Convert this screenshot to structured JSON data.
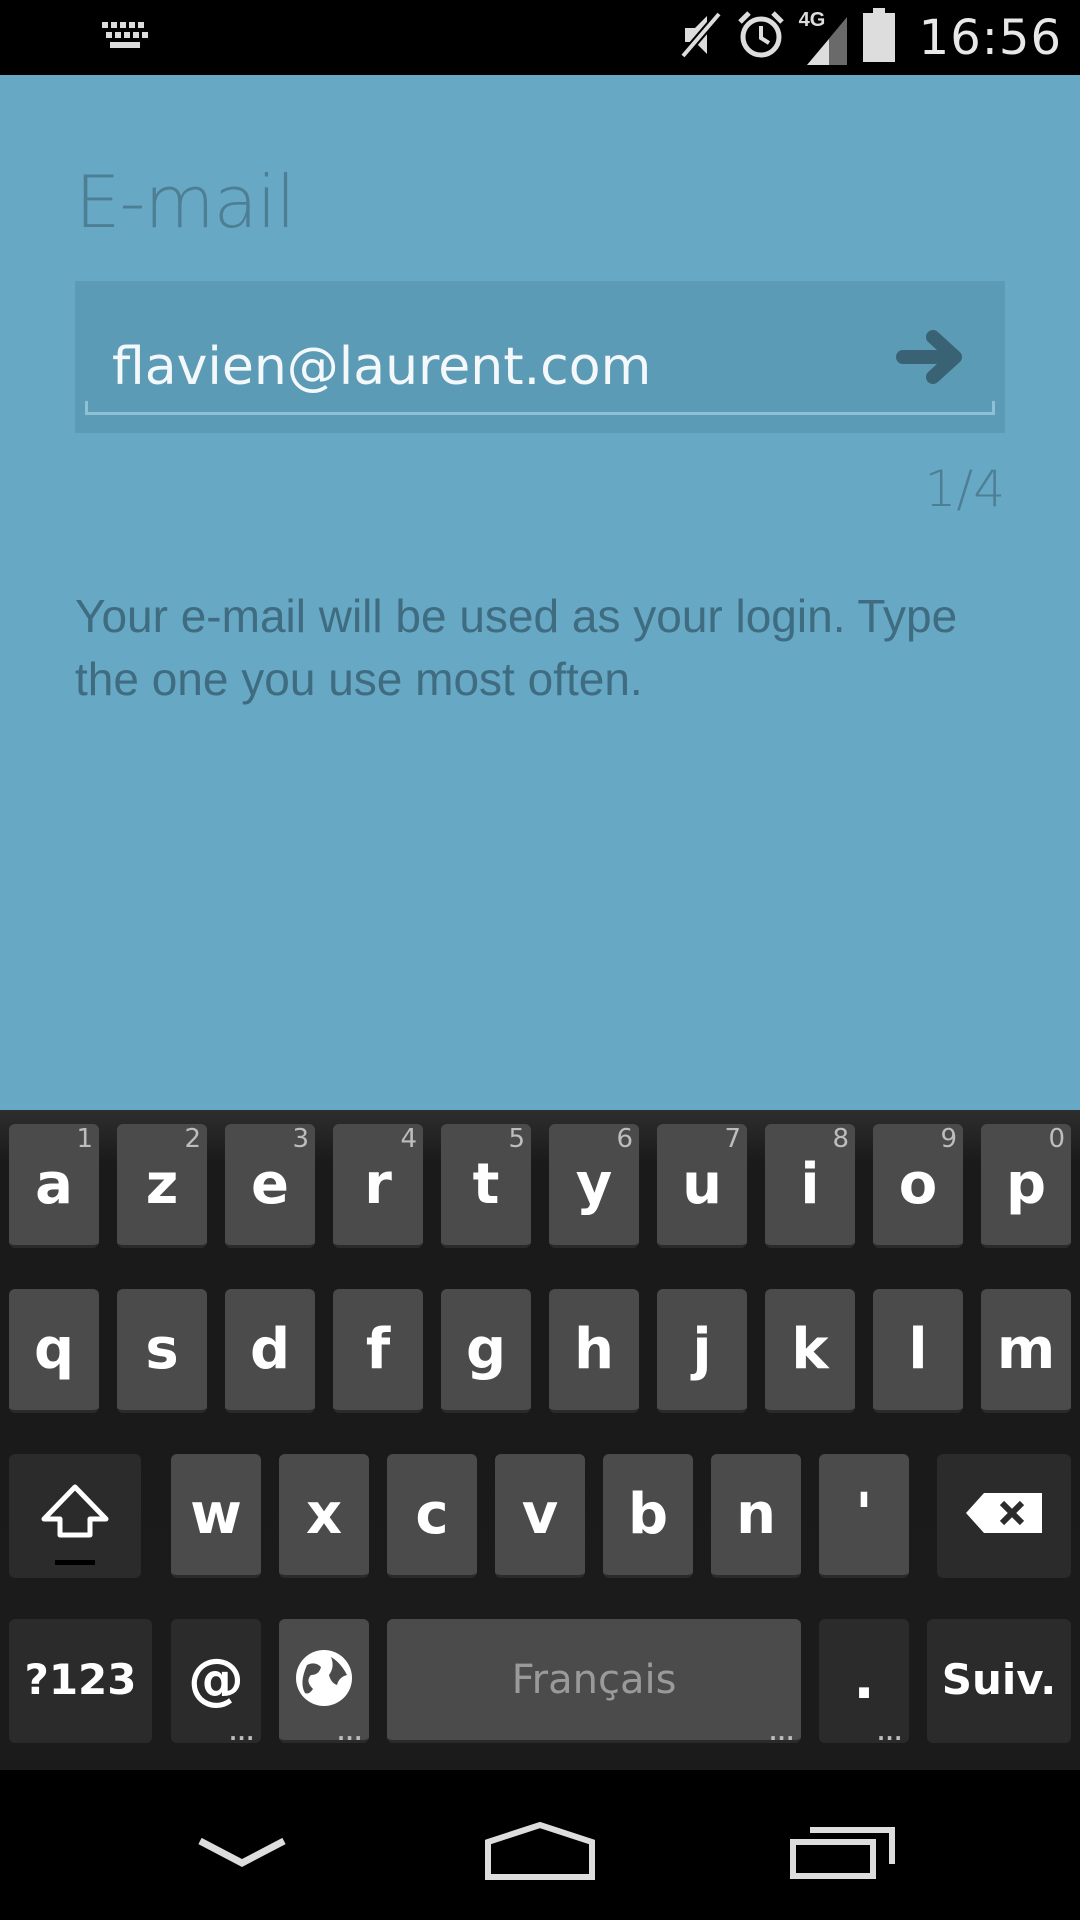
{
  "status_bar": {
    "time": "16:56",
    "network": "4G",
    "icons": [
      "keyboard-icon",
      "mute-icon",
      "alarm-icon",
      "signal-icon",
      "battery-icon"
    ]
  },
  "form": {
    "title": "E-mail",
    "email_value": "flavien@laurent.com",
    "step_counter": "1/4",
    "help_text": "Your e-mail will be used as your login. Type the one you use most often.",
    "next_icon": "arrow-right-icon"
  },
  "keyboard": {
    "row1": [
      {
        "label": "a",
        "hint": "1"
      },
      {
        "label": "z",
        "hint": "2"
      },
      {
        "label": "e",
        "hint": "3"
      },
      {
        "label": "r",
        "hint": "4"
      },
      {
        "label": "t",
        "hint": "5"
      },
      {
        "label": "y",
        "hint": "6"
      },
      {
        "label": "u",
        "hint": "7"
      },
      {
        "label": "i",
        "hint": "8"
      },
      {
        "label": "o",
        "hint": "9"
      },
      {
        "label": "p",
        "hint": "0"
      }
    ],
    "row2": [
      "q",
      "s",
      "d",
      "f",
      "g",
      "h",
      "j",
      "k",
      "l",
      "m"
    ],
    "row3": [
      "w",
      "x",
      "c",
      "v",
      "b",
      "n",
      "'"
    ],
    "symbols_label": "?123",
    "at_label": "@",
    "space_label": "Français",
    "period_label": ".",
    "action_label": "Suiv."
  },
  "colors": {
    "background": "#67a8c4",
    "input_background": "#5b9bb6",
    "title_text": "#4d7e93",
    "help_text": "#3f6c80",
    "key": "#4b4b4b",
    "key_dark": "#2b2b2b"
  }
}
